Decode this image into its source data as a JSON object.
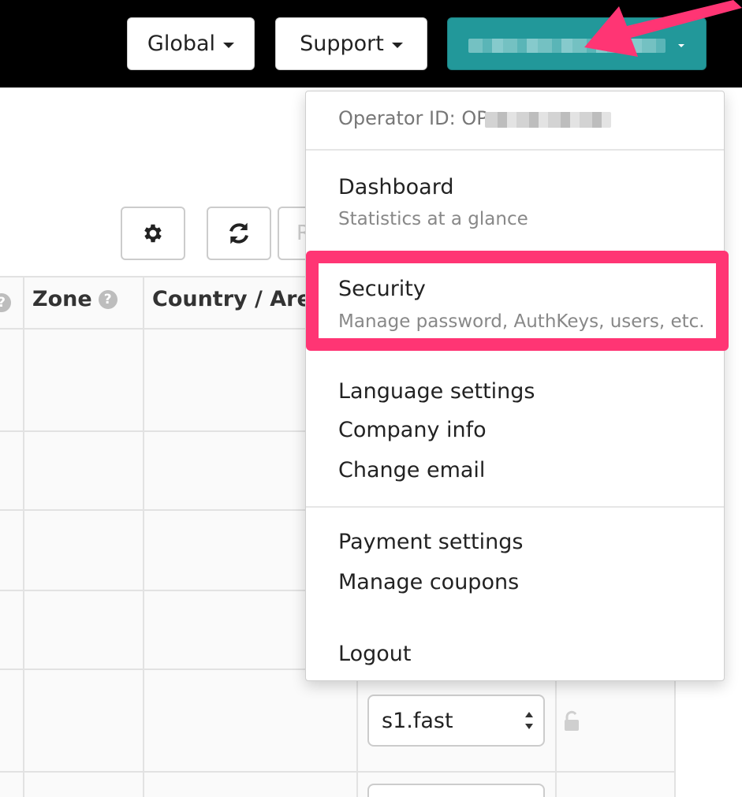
{
  "navbar": {
    "global_label": "Global",
    "support_label": "Support",
    "account_label": ""
  },
  "table": {
    "headers": [
      "Zone",
      "Country / Are"
    ],
    "select_value": "s1.fast",
    "partial_button_label": "R"
  },
  "dropdown": {
    "operator_id_label": "Operator ID: OP",
    "items": [
      {
        "label": "Dashboard",
        "sublabel": "Statistics at a glance"
      },
      {
        "label": "Security",
        "sublabel": "Manage password, AuthKeys, users, etc."
      },
      {
        "label": "Language settings"
      },
      {
        "label": "Company info"
      },
      {
        "label": "Change email"
      },
      {
        "label": "Payment settings"
      },
      {
        "label": "Manage coupons"
      },
      {
        "label": "Logout"
      }
    ]
  },
  "colors": {
    "navbar_bg": "#000000",
    "account_button": "#22989a",
    "annotation": "#ff3574"
  },
  "icons": [
    "caret-down-icon",
    "gear-icon",
    "refresh-icon",
    "help-icon",
    "lock-icon",
    "select-arrows-icon",
    "annotation-arrow"
  ]
}
